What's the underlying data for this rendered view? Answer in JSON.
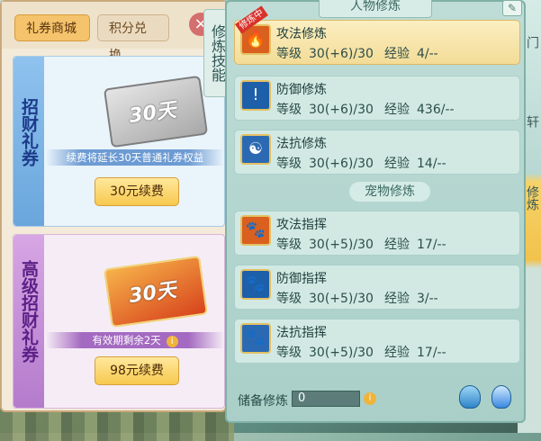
{
  "background": {
    "right_top": "门",
    "right_mid": "轩",
    "right_low": "修炼"
  },
  "shop": {
    "tabs": [
      {
        "label": "礼券商城"
      },
      {
        "label": "积分兑换"
      }
    ],
    "cards": [
      {
        "side_title": "招财礼券",
        "ticket": "30天",
        "note": "续费将延长30天普通礼券权益",
        "button": "30元续费"
      },
      {
        "side_title": "高级招财礼券",
        "ticket": "30天",
        "note": "有效期剩余2天",
        "button": "98元续费"
      }
    ]
  },
  "vertical_tab": "修炼技能",
  "cultivation": {
    "header": "人物修炼",
    "level_label": "等级",
    "exp_label": "经验",
    "badge": "修炼中",
    "character_skills": [
      {
        "name": "攻法修炼",
        "level": "30(+6)/30",
        "exp": "4/--",
        "icon": "attack-magic-icon"
      },
      {
        "name": "防御修炼",
        "level": "30(+6)/30",
        "exp": "436/--",
        "icon": "defense-icon"
      },
      {
        "name": "法抗修炼",
        "level": "30(+6)/30",
        "exp": "14/--",
        "icon": "magic-resist-icon"
      }
    ],
    "pet_header": "宠物修炼",
    "pet_skills": [
      {
        "name": "攻法指挥",
        "level": "30(+5)/30",
        "exp": "17/--",
        "icon": "pet-attack-icon"
      },
      {
        "name": "防御指挥",
        "level": "30(+5)/30",
        "exp": "3/--",
        "icon": "pet-defense-icon"
      },
      {
        "name": "法抗指挥",
        "level": "30(+5)/30",
        "exp": "17/--",
        "icon": "pet-resist-icon"
      }
    ],
    "reserve_label": "储备修炼",
    "reserve_value": "0"
  }
}
